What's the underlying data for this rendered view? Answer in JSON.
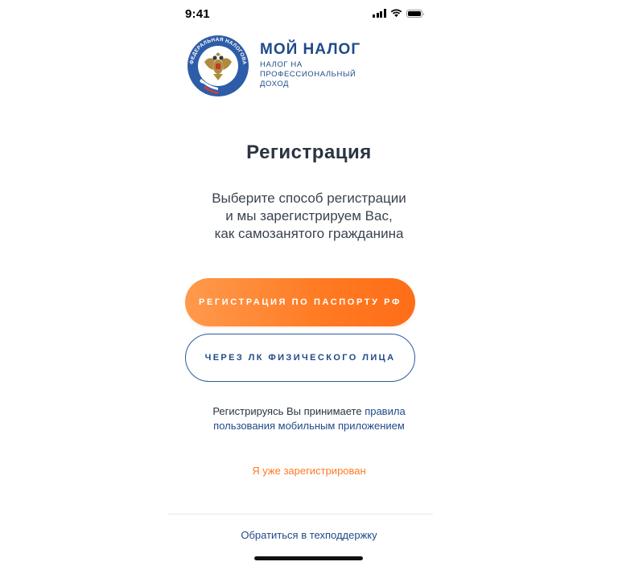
{
  "status_bar": {
    "time": "9:41",
    "icons": [
      "cellular-signal-icon",
      "wifi-icon",
      "battery-icon"
    ]
  },
  "logo": {
    "emblem_text": "ФЕДЕРАЛЬНАЯ НАЛОГОВАЯ СЛУЖБА",
    "title": "МОЙ НАЛОГ",
    "subtitle_line1": "НАЛОГ НА",
    "subtitle_line2": "ПРОФЕССИОНАЛЬНЫЙ",
    "subtitle_line3": "ДОХОД"
  },
  "page": {
    "title": "Регистрация",
    "description_line1": "Выберите способ регистрации",
    "description_line2": "и мы зарегистрируем Вас,",
    "description_line3": "как самозанятого гражданина"
  },
  "buttons": {
    "passport": "РЕГИСТРАЦИЯ ПО ПАСПОРТУ РФ",
    "personal_account": "ЧЕРЕЗ ЛК ФИЗИЧЕСКОГО ЛИЦА"
  },
  "terms": {
    "prefix": "Регистрируясь Вы принимаете ",
    "link_part1": "правила",
    "link_part2": "пользования мобильным приложением"
  },
  "links": {
    "already_registered": "Я уже зарегистрирован",
    "support": "Обратиться в техподдержку"
  },
  "colors": {
    "accent_orange": "#ff7a22",
    "brand_blue": "#1f4a8a",
    "text_dark": "#2b3441"
  }
}
